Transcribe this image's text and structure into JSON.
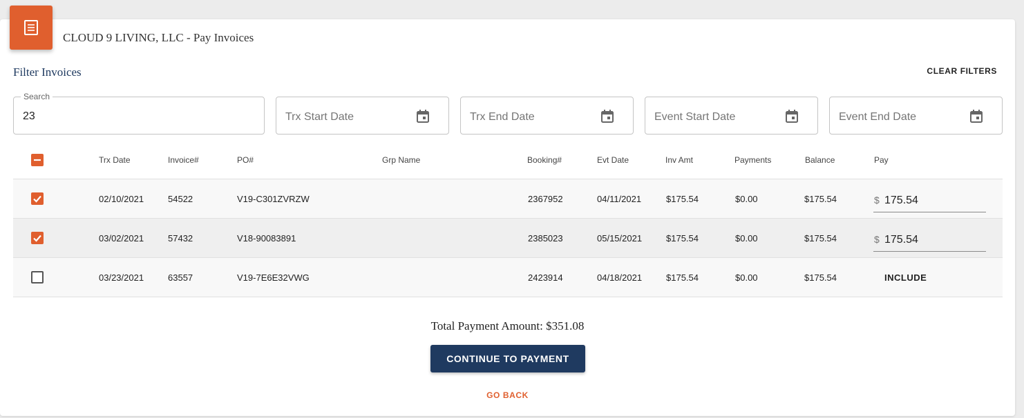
{
  "header": {
    "icon": "receipt-icon",
    "title": "CLOUD 9 LIVING, LLC - Pay Invoices"
  },
  "filters": {
    "title": "Filter Invoices",
    "clear_label": "CLEAR FILTERS",
    "search": {
      "label": "Search",
      "value": "23"
    },
    "trx_start": {
      "placeholder": "Trx Start Date",
      "icon": "calendar-icon"
    },
    "trx_end": {
      "placeholder": "Trx End Date",
      "icon": "calendar-icon"
    },
    "event_start": {
      "placeholder": "Event Start Date",
      "icon": "calendar-icon"
    },
    "event_end": {
      "placeholder": "Event End Date",
      "icon": "calendar-icon"
    }
  },
  "table": {
    "select_all_state": "indeterminate",
    "columns": [
      "Trx Date",
      "Invoice#",
      "PO#",
      "Grp Name",
      "Booking#",
      "Evt Date",
      "Inv Amt",
      "Payments",
      "Balance",
      "Pay"
    ],
    "rows": [
      {
        "checked": true,
        "trx_date": "02/10/2021",
        "invoice": "54522",
        "po": "V19-C301ZVRZW",
        "grp_name": "",
        "booking": "2367952",
        "evt_date": "04/11/2021",
        "inv_amt": "$175.54",
        "payments": "$0.00",
        "balance": "$175.54",
        "pay_currency": "$",
        "pay_amount": "175.54"
      },
      {
        "checked": true,
        "trx_date": "03/02/2021",
        "invoice": "57432",
        "po": "V18-90083891",
        "grp_name": "",
        "booking": "2385023",
        "evt_date": "05/15/2021",
        "inv_amt": "$175.54",
        "payments": "$0.00",
        "balance": "$175.54",
        "pay_currency": "$",
        "pay_amount": "175.54"
      },
      {
        "checked": false,
        "trx_date": "03/23/2021",
        "invoice": "63557",
        "po": "V19-7E6E32VWG",
        "grp_name": "",
        "booking": "2423914",
        "evt_date": "04/18/2021",
        "inv_amt": "$175.54",
        "payments": "$0.00",
        "balance": "$175.54",
        "pay_action": "INCLUDE"
      }
    ]
  },
  "summary": {
    "total_label": "Total Payment Amount: $351.08",
    "continue_label": "CONTINUE TO PAYMENT",
    "back_label": "GO BACK"
  },
  "colors": {
    "accent": "#e05f2e",
    "primary": "#1f3a60"
  }
}
